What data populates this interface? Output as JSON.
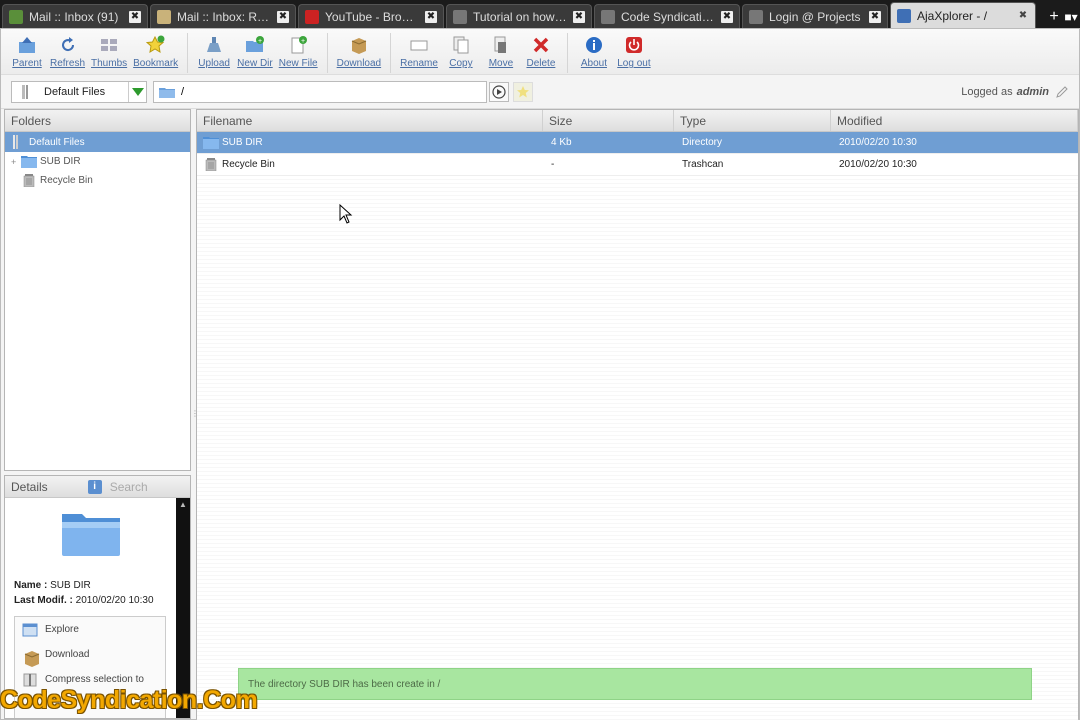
{
  "browser": {
    "tabs": [
      {
        "title": "Mail :: Inbox (91)",
        "favicon": "mail-favicon-icon",
        "color": "#5a8f3a",
        "active": false
      },
      {
        "title": "Mail :: Inbox: Re: ...",
        "favicon": "envelope-favicon-icon",
        "color": "#c9b27a",
        "active": false
      },
      {
        "title": "YouTube - Broadc...",
        "favicon": "youtube-favicon-icon",
        "color": "#cc2222",
        "active": false
      },
      {
        "title": "Tutorial on how t...",
        "favicon": "page-favicon-icon",
        "color": "#777777",
        "active": false
      },
      {
        "title": "Code Syndication ...",
        "favicon": "page-favicon-icon",
        "color": "#777777",
        "active": false
      },
      {
        "title": "Login @ Projects",
        "favicon": "page-favicon-icon",
        "color": "#777777",
        "active": false
      },
      {
        "title": "AjaXplorer - /",
        "favicon": "ajaxplorer-favicon-icon",
        "color": "#3f6fb5",
        "active": true
      }
    ],
    "newtab_label": "+"
  },
  "toolbar": {
    "groups": [
      [
        {
          "key": "parent",
          "label": "Parent",
          "icon": "parent-icon"
        },
        {
          "key": "refresh",
          "label": "Refresh",
          "icon": "refresh-icon"
        },
        {
          "key": "thumbs",
          "label": "Thumbs",
          "icon": "thumbs-icon"
        },
        {
          "key": "bookmark",
          "label": "Bookmark",
          "icon": "bookmark-icon"
        }
      ],
      [
        {
          "key": "upload",
          "label": "Upload",
          "icon": "upload-icon"
        },
        {
          "key": "newdir",
          "label": "New Dir",
          "icon": "new-dir-icon"
        },
        {
          "key": "newfile",
          "label": "New File",
          "icon": "new-file-icon"
        }
      ],
      [
        {
          "key": "download",
          "label": "Download",
          "icon": "download-icon"
        }
      ],
      [
        {
          "key": "rename",
          "label": "Rename",
          "icon": "rename-icon"
        },
        {
          "key": "copy",
          "label": "Copy",
          "icon": "copy-icon"
        },
        {
          "key": "move",
          "label": "Move",
          "icon": "move-icon"
        },
        {
          "key": "delete",
          "label": "Delete",
          "icon": "delete-icon"
        }
      ],
      [
        {
          "key": "about",
          "label": "About",
          "icon": "info-icon"
        },
        {
          "key": "logout",
          "label": "Log out",
          "icon": "power-icon"
        }
      ]
    ]
  },
  "location": {
    "repository": "Default Files",
    "path": "/",
    "logged_prefix": "Logged as",
    "user": "admin"
  },
  "folders": {
    "header": "Folders",
    "root": "Default Files",
    "items": [
      {
        "label": "SUB DIR",
        "icon": "folder-icon",
        "expandable": true
      },
      {
        "label": "Recycle Bin",
        "icon": "trash-icon",
        "expandable": false
      }
    ]
  },
  "details": {
    "header": "Details",
    "search_tab": "Search",
    "name_label": "Name :",
    "name_value": "SUB DIR",
    "modif_label": "Last Modif. :",
    "modif_value": "2010/02/20 10:30",
    "actions": [
      {
        "label": "Explore",
        "icon": "explore-icon"
      },
      {
        "label": "Download",
        "icon": "download-icon"
      },
      {
        "label": "Compress selection to",
        "icon": "compress-icon"
      }
    ]
  },
  "filelist": {
    "columns": [
      "Filename",
      "Size",
      "Type",
      "Modified"
    ],
    "rows": [
      {
        "name": "SUB DIR",
        "size": "4 Kb",
        "type": "Directory",
        "modified": "2010/02/20 10:30",
        "icon": "folder-icon",
        "selected": true
      },
      {
        "name": "Recycle Bin",
        "size": "-",
        "type": "Trashcan",
        "modified": "2010/02/20 10:30",
        "icon": "trash-icon",
        "selected": false
      }
    ]
  },
  "message": "The directory SUB DIR has been create in /",
  "watermark": "CodeSyndication.Com",
  "colors": {
    "selection": "#6f9ed3",
    "message_bg": "#a8e6a0",
    "link": "#4a6fa5",
    "watermark": "#f3a800"
  }
}
